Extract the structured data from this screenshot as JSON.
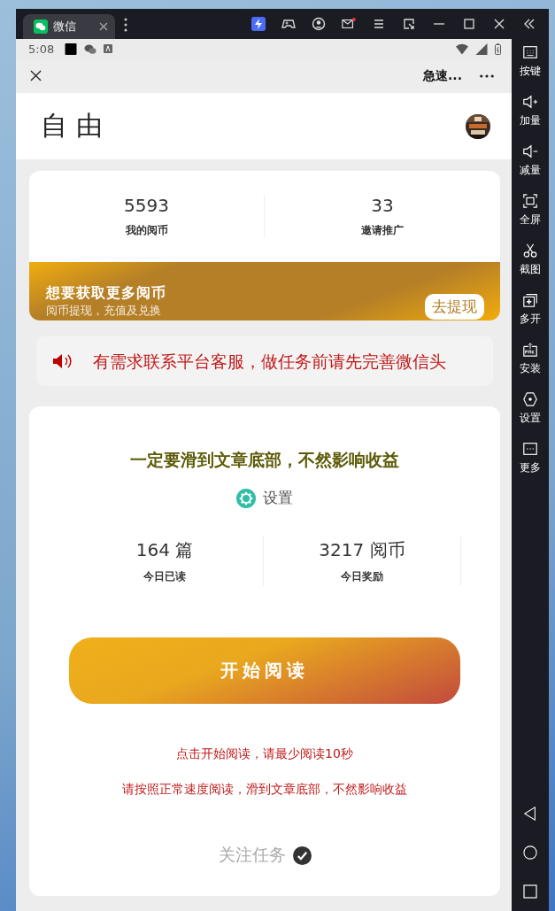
{
  "window": {
    "tab": "微信",
    "mail_badge": true
  },
  "status_bar": {
    "time": "5:08"
  },
  "nav": {
    "title": "急速..."
  },
  "header": {
    "title": "自由"
  },
  "stats": [
    {
      "value": "5593",
      "label": "我的阅币"
    },
    {
      "value": "33",
      "label": "邀请推广"
    }
  ],
  "banner": {
    "title": "想要获取更多阅币",
    "subtitle": "阅币提现，充值及兑换",
    "button": "去提现"
  },
  "notice": "有需求联系平台客服，做任务前请先完善微信头",
  "main": {
    "heading": "一定要滑到文章底部，不然影响收益",
    "settings": "设置",
    "today": [
      {
        "value": "164 篇",
        "label": "今日已读"
      },
      {
        "value": "3217 阅币",
        "label": "今日奖励"
      }
    ],
    "start_button": "开始阅读",
    "tips": [
      "点击开始阅读，请最少阅读10秒",
      "请按照正常速度阅读，滑到文章底部，不然影响收益"
    ],
    "follow": {
      "label": "关注任务",
      "done": true
    }
  },
  "sidebar": [
    {
      "label": "按键"
    },
    {
      "label": "加量"
    },
    {
      "label": "减量"
    },
    {
      "label": "全屏"
    },
    {
      "label": "截图"
    },
    {
      "label": "多开"
    },
    {
      "label": "安装"
    },
    {
      "label": "设置"
    },
    {
      "label": "更多"
    }
  ]
}
